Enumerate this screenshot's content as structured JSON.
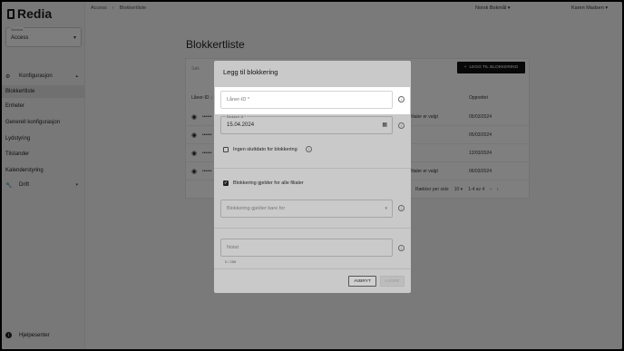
{
  "app": {
    "brand": "Redia"
  },
  "sidebar": {
    "service_label": "Service",
    "service_value": "Access",
    "items": [
      {
        "label": "Konfigurasjon",
        "icon": "gear-icon"
      },
      {
        "label": "Blokkertliste"
      },
      {
        "label": "Enheter"
      },
      {
        "label": "Generell konfigurasjon"
      },
      {
        "label": "Lydstyring"
      },
      {
        "label": "Tilstander"
      },
      {
        "label": "Kalenderstyring"
      },
      {
        "label": "Drift",
        "icon": "wrench-icon"
      }
    ],
    "help": "Hjelpesenter"
  },
  "topbar": {
    "breadcrumb": [
      "Access",
      "Blokkertliste"
    ],
    "language": "Norsk Bokmål",
    "user": "Karen Madsen"
  },
  "page": {
    "title": "Blokkertliste",
    "add_button": "LEGG TIL BLOKKERING",
    "search_placeholder": "Søk",
    "col_lanerid": "Låner-ID",
    "col_opprettet": "Opprettet",
    "rows": [
      {
        "filial": "filialer er valgt",
        "date": "05/03/2024"
      },
      {
        "filial": "",
        "date": "05/03/2024"
      },
      {
        "filial": "",
        "date": "12/03/2024"
      },
      {
        "filial": "filialer er valgt",
        "date": "06/03/2024"
      }
    ],
    "rows_per_page_label": "Rækker per side",
    "rows_per_page_value": "10",
    "range": "1-4 av 4"
  },
  "modal": {
    "title": "Legg til blokkering",
    "laner_id_placeholder": "Låner-ID *",
    "blokkert_til_label": "Blokkert til *",
    "blokkert_til_value": "15.04.2024",
    "no_end_date_label": "Ingen sluttdato for blokkering",
    "no_end_date_checked": false,
    "all_branches_label": "Blokkering gjelder for alle filialer",
    "all_branches_checked": true,
    "branches_placeholder": "Blokkering gjelder bare for",
    "note_placeholder": "Notat",
    "note_counter": "0 / 255",
    "cancel_label": "AVBRYT",
    "save_label": "LAGRE"
  }
}
